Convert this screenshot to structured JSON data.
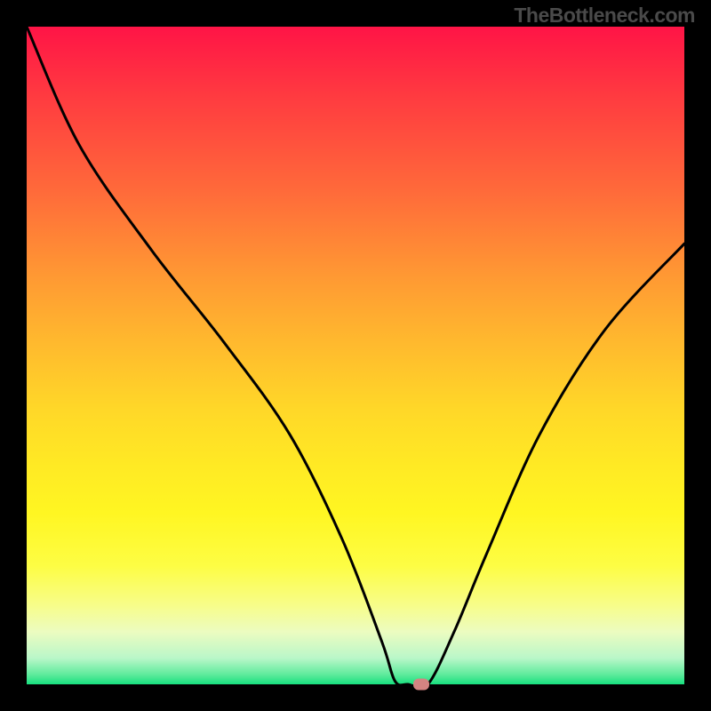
{
  "attribution": "TheBottleneck.com",
  "chart_data": {
    "type": "line",
    "title": "",
    "xlabel": "",
    "ylabel": "",
    "xlim": [
      0,
      100
    ],
    "ylim": [
      0,
      100
    ],
    "series": [
      {
        "name": "bottleneck-curve",
        "x": [
          0,
          8,
          19,
          30,
          40,
          48,
          54,
          56,
          58,
          61,
          65,
          70,
          78,
          88,
          100
        ],
        "values": [
          100,
          82,
          66,
          52,
          38,
          22,
          6.5,
          0.5,
          0,
          0,
          8,
          20,
          38,
          54,
          67
        ]
      }
    ],
    "marker": {
      "x": 60,
      "y": 0
    },
    "colors": {
      "curve": "#000000",
      "marker": "#d38482",
      "gradient_top": "#ff1446",
      "gradient_bottom": "#17e07e"
    }
  }
}
